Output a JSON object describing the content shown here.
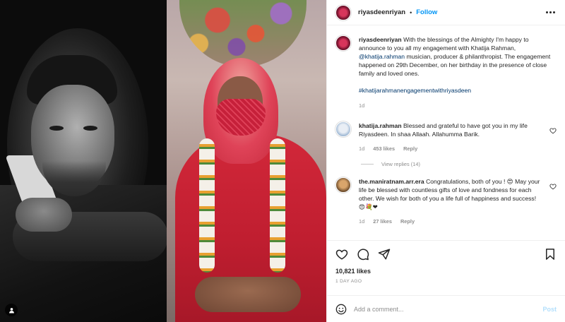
{
  "post": {
    "author": "riyasdeenriyan",
    "separator": "•",
    "follow_label": "Follow",
    "caption": {
      "username": "riyasdeenriyan",
      "text_before_mention": "With the blessings of the Almighty I'm happy to announce to you all my engagement with Khatija Rahman,",
      "mention": "@khatija.rahman",
      "text_after_mention": "musician, producer & philanthropist. The engagement happened on 29th December, on her birthday in the presence of close family and loved ones.",
      "hashtag": "#khatijarahmanengagementwithriyasdeen",
      "time": "1d"
    },
    "comments": [
      {
        "username": "khatija.rahman",
        "text": "Blessed and grateful to have got you in my life Riyasdeen. In shaa Allaah. Allahumma Barik.",
        "time": "1d",
        "likes": "453 likes",
        "reply_label": "Reply",
        "view_replies": "View replies (14)"
      },
      {
        "username": "the.maniratnam.arr.era",
        "text": "Congratulations, both of you ! 😍 May your life be blessed with countless gifts of love and fondness for each other. We wish for both of you a life full of happiness and success! 😍💐❤",
        "time": "1d",
        "likes": "27 likes",
        "reply_label": "Reply"
      }
    ],
    "likes": "10,821 likes",
    "posted_ago": "1 DAY AGO",
    "add_comment_placeholder": "Add a comment...",
    "post_label": "Post"
  },
  "colors": {
    "link_blue": "#0095f6",
    "mention_blue": "#00376b",
    "muted_gray": "#8e8e8e",
    "post_disabled": "#b2dffc"
  },
  "icons": [
    "user-tag-icon",
    "more-options-icon",
    "heart-icon",
    "comment-icon",
    "share-icon",
    "bookmark-icon",
    "emoji-icon"
  ]
}
